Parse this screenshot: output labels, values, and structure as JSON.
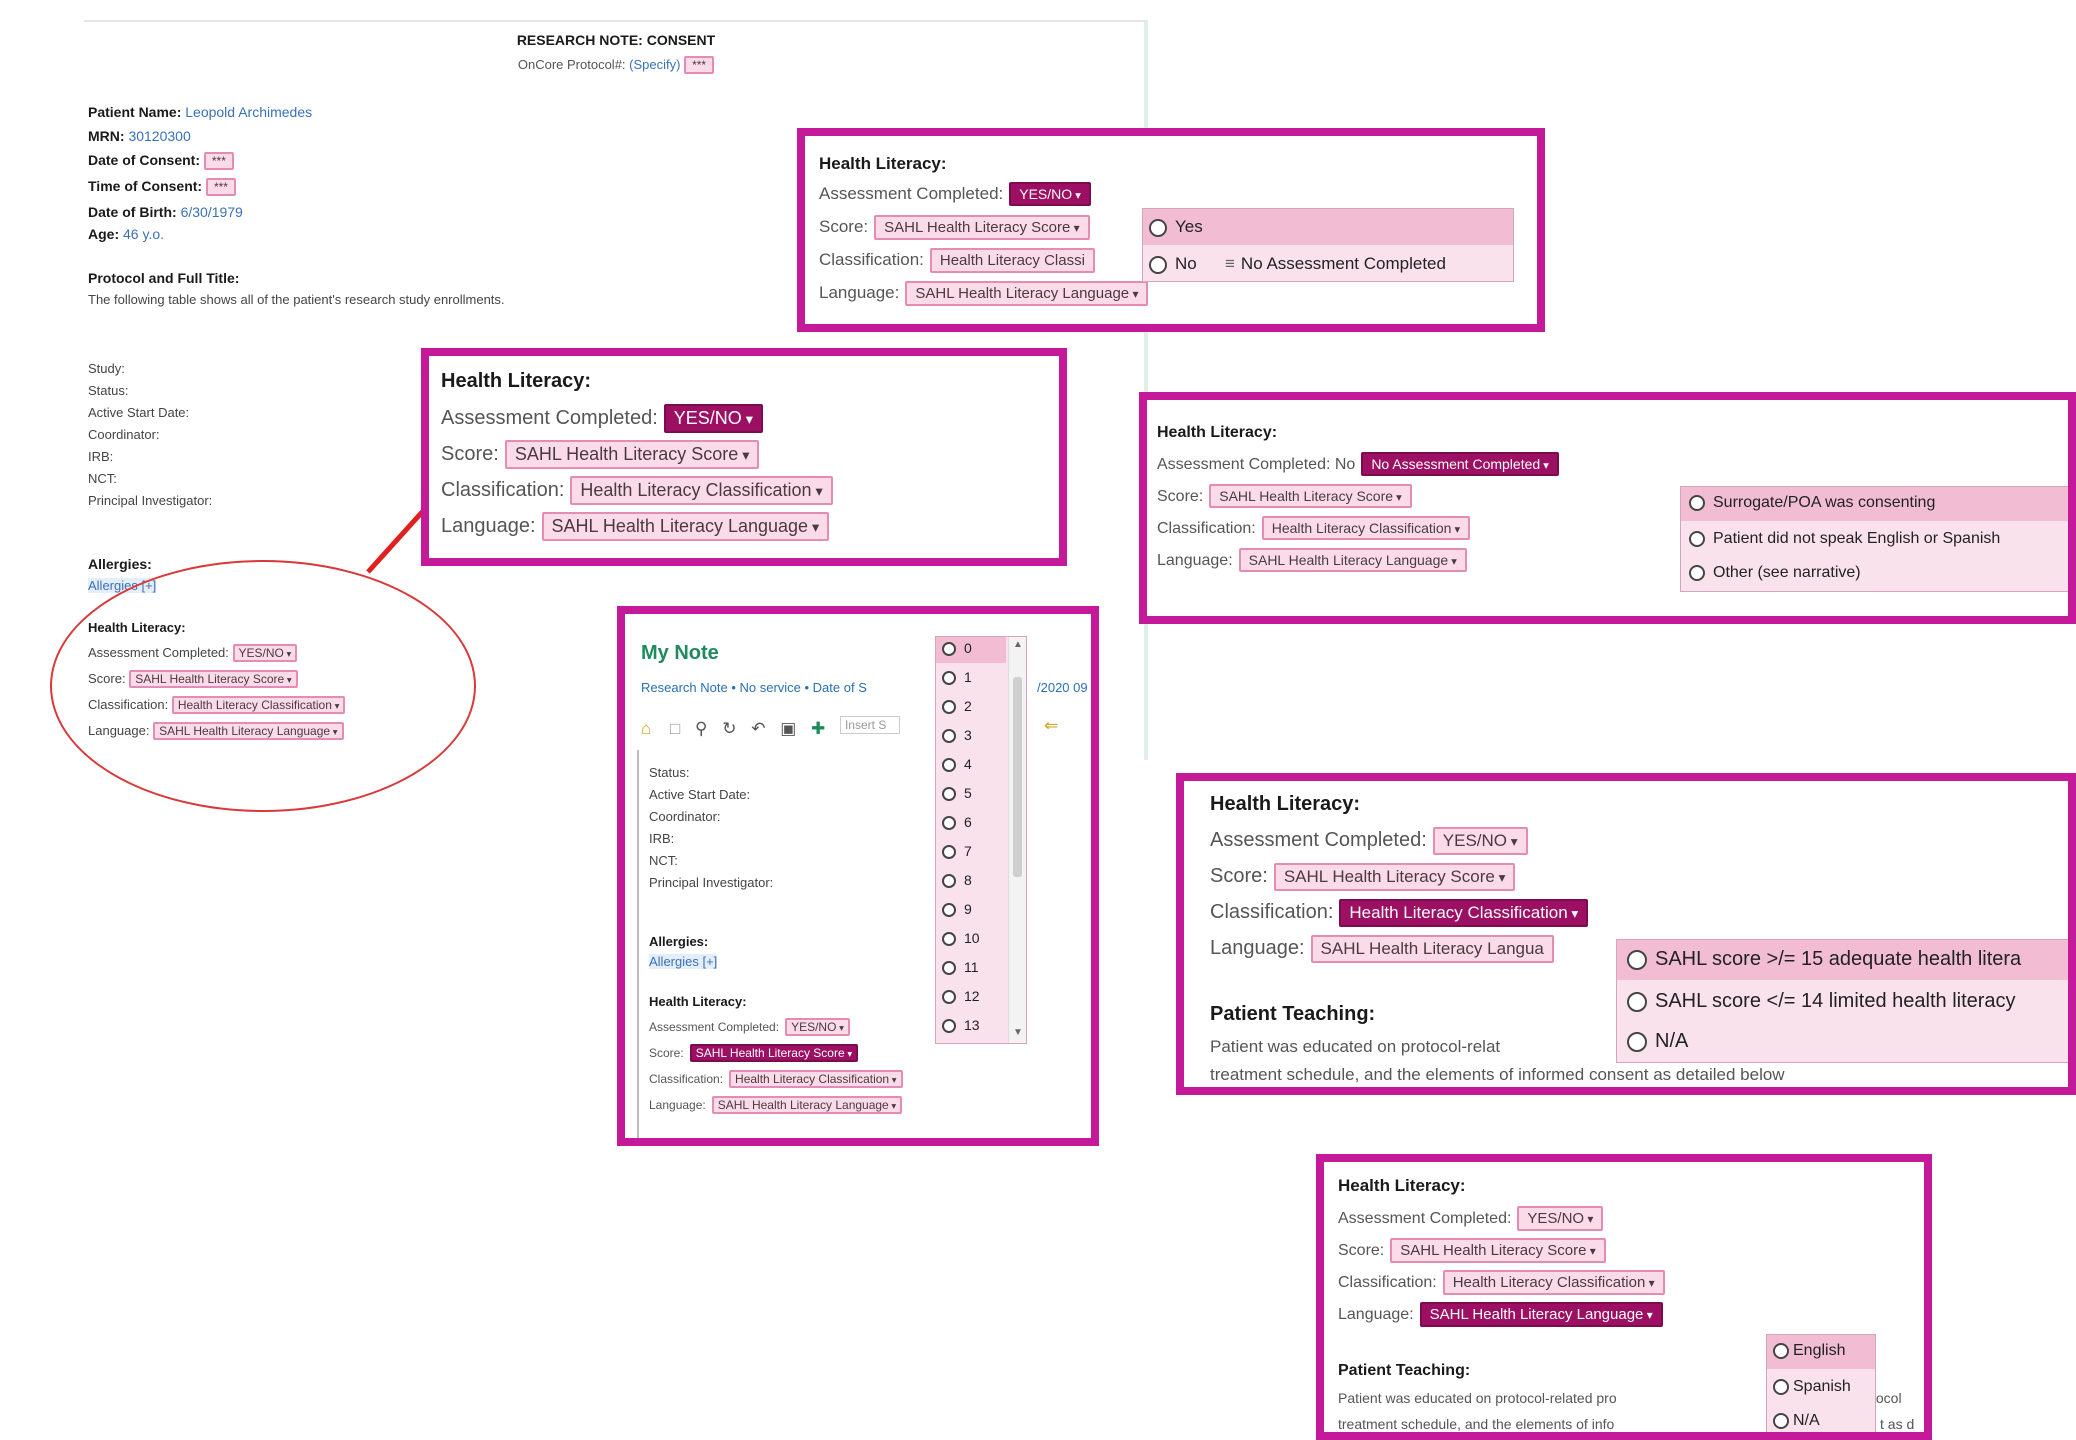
{
  "note": {
    "title": "RESEARCH NOTE: CONSENT",
    "oncore_label": "OnCore Protocol#:",
    "oncore_value": "(Specify)",
    "oncore_field": "***",
    "patient_name_label": "Patient Name:",
    "patient_name_value": "Leopold Archimedes",
    "mrn_label": "MRN:",
    "mrn_value": "30120300",
    "date_consent_label": "Date of Consent:",
    "date_consent_field": "***",
    "time_consent_label": "Time of Consent:",
    "time_consent_field": "***",
    "dob_label": "Date of Birth:",
    "dob_value": "6/30/1979",
    "age_label": "Age:",
    "age_value": "46 y.o.",
    "protocol_label": "Protocol and Full Title:",
    "protocol_desc": "The following table shows all of the patient's research study enrollments.",
    "study_fields": [
      "Study:",
      "Status:",
      "Active Start Date:",
      "Coordinator:",
      "IRB:",
      "NCT:",
      "Principal Investigator:"
    ],
    "allergies_label": "Allergies:",
    "allergies_value": "Allergies [+]",
    "hl_label": "Health Literacy:",
    "assessment_label": "Assessment Completed:",
    "assessment_field": "YES/NO",
    "score_label": "Score:",
    "score_field": "SAHL Health Literacy Score",
    "class_label": "Classification:",
    "class_field": "Health Literacy Classification",
    "lang_label": "Language:",
    "lang_field": "SAHL Health Literacy Language"
  },
  "panel1": {
    "heading": "Health Literacy:",
    "assessment_label": "Assessment Completed:",
    "assessment_field": "YES/NO",
    "score_label": "Score:",
    "score_field": "SAHL Health Literacy Score",
    "class_label": "Classification:",
    "class_field": "Health Literacy Classi",
    "lang_label": "Language:",
    "lang_field": "SAHL Health Literacy Language",
    "options": [
      "Yes",
      "No"
    ],
    "extra_option": "No Assessment Completed"
  },
  "panel2": {
    "heading": "Health Literacy:",
    "assessment_label": "Assessment Completed:",
    "assessment_field": "YES/NO",
    "score_label": "Score:",
    "score_field": "SAHL Health Literacy Score",
    "class_label": "Classification:",
    "class_field": "Health Literacy Classification",
    "lang_label": "Language:",
    "lang_field": "SAHL Health Literacy Language"
  },
  "panel3": {
    "heading": "Health Literacy:",
    "assessment_label": "Assessment Completed: No",
    "assessment_field": "No Assessment Completed",
    "score_label": "Score:",
    "score_field": "SAHL Health Literacy Score",
    "class_label": "Classification:",
    "class_field": "Health Literacy Classification",
    "lang_label": "Language:",
    "lang_field": "SAHL Health Literacy Language",
    "options": [
      "Surrogate/POA was consenting",
      "Patient did not speak English or Spanish",
      "Other (see narrative)"
    ]
  },
  "panel4": {
    "title": "My Note",
    "subtitle": "Research Note • No service • Date of S",
    "date_fragment": "/2020 09",
    "insert_placeholder": "Insert S",
    "study_fields": [
      "Status:",
      "Active Start Date:",
      "Coordinator:",
      "IRB:",
      "NCT:",
      "Principal Investigator:"
    ],
    "allergies_label": "Allergies:",
    "allergies_value": "Allergies [+]",
    "hl_label": "Health Literacy:",
    "assessment_label": "Assessment Completed:",
    "assessment_field": "YES/NO",
    "score_label": "Score:",
    "score_field": "SAHL Health Literacy Score",
    "class_label": "Classification:",
    "class_field": "Health Literacy Classification",
    "lang_label": "Language:",
    "lang_field": "SAHL Health Literacy Language",
    "options": [
      "0",
      "1",
      "2",
      "3",
      "4",
      "5",
      "6",
      "7",
      "8",
      "9",
      "10",
      "11",
      "12",
      "13"
    ]
  },
  "panel5": {
    "heading": "Health Literacy:",
    "assessment_label": "Assessment Completed:",
    "assessment_field": "YES/NO",
    "score_label": "Score:",
    "score_field": "SAHL Health Literacy Score",
    "class_label": "Classification:",
    "class_field": "Health Literacy Classification",
    "lang_label": "Language:",
    "lang_field": "SAHL Health Literacy Langua",
    "teaching_heading": "Patient Teaching:",
    "teaching_line1": "Patient was educated on protocol-relat",
    "teaching_line2": "treatment schedule, and the elements of informed consent as detailed below",
    "options": [
      "SAHL score >/= 15 adequate health litera",
      "SAHL score </= 14 limited health literacy",
      "N/A"
    ]
  },
  "panel6": {
    "heading": "Health Literacy:",
    "assessment_label": "Assessment Completed:",
    "assessment_field": "YES/NO",
    "score_label": "Score:",
    "score_field": "SAHL Health Literacy Score",
    "class_label": "Classification:",
    "class_field": "Health Literacy Classification",
    "lang_label": "Language:",
    "lang_field": "SAHL Health Literacy Language",
    "teaching_heading": "Patient Teaching:",
    "teaching_line1": "Patient was educated on protocol-related pro",
    "teaching_line1_tail": "tocol",
    "teaching_line2": "treatment schedule, and the elements of info",
    "teaching_line2_tail": "t as d",
    "options": [
      "English",
      "Spanish",
      "N/A"
    ]
  },
  "colors": {
    "panel_border": "#c41a9a",
    "field_fill": "#fbdbe8",
    "field_selected": "#9c0f63",
    "annotation_red": "#d83a3a",
    "title_green": "#1f8a5c",
    "link_blue": "#3a70b8"
  }
}
